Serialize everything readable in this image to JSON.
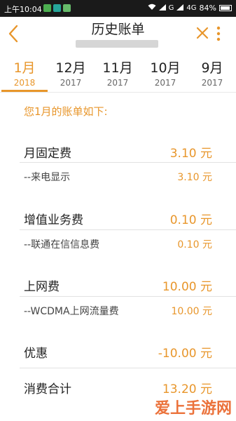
{
  "status_bar": {
    "time": "上午10:04",
    "network": "G",
    "network2": "4G",
    "battery": "84%"
  },
  "header": {
    "title": "历史账单",
    "back_icon": "chevron-left-icon",
    "close_icon": "close-icon",
    "more_icon": "more-vertical-icon",
    "accent_color": "#e8962b"
  },
  "tabs": [
    {
      "month": "1月",
      "year": "2018",
      "active": true
    },
    {
      "month": "12月",
      "year": "2017",
      "active": false
    },
    {
      "month": "11月",
      "year": "2017",
      "active": false
    },
    {
      "month": "10月",
      "year": "2017",
      "active": false
    },
    {
      "month": "9月",
      "year": "2017",
      "active": false
    }
  ],
  "bill": {
    "intro": "您1月的账单如下:",
    "items": [
      {
        "label": "月固定费",
        "value": "3.10 元"
      },
      {
        "label": "--来电显示",
        "value": "3.10 元"
      },
      {
        "label": "增值业务费",
        "value": "0.10 元"
      },
      {
        "label": "--联通在信信息费",
        "value": "0.10 元"
      },
      {
        "label": "上网费",
        "value": "10.00 元"
      },
      {
        "label": "--WCDMA上网流量费",
        "value": "10.00 元"
      },
      {
        "label": "优惠",
        "value": "-10.00 元"
      },
      {
        "label": "消费合计",
        "value": "13.20 元"
      }
    ]
  },
  "watermark": "爱上手游网"
}
